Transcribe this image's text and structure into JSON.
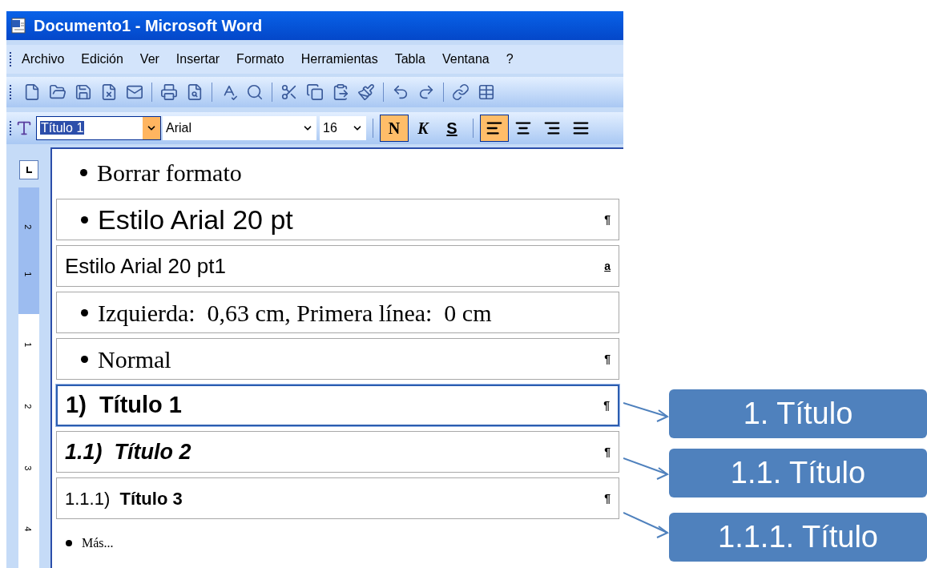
{
  "window": {
    "title": "Documento1 - Microsoft Word"
  },
  "menu": [
    "Archivo",
    "Edición",
    "Ver",
    "Insertar",
    "Formato",
    "Herramientas",
    "Tabla",
    "Ventana",
    "?"
  ],
  "format_bar": {
    "style": "Título 1",
    "font": "Arial",
    "size": "16",
    "buttons": [
      {
        "label": "N",
        "kind": "bold",
        "selected": true
      },
      {
        "label": "K",
        "kind": "italic",
        "selected": false
      },
      {
        "label": "S",
        "kind": "underline",
        "selected": false
      }
    ],
    "align": [
      {
        "kind": "left",
        "selected": true
      },
      {
        "kind": "center",
        "selected": false
      },
      {
        "kind": "right",
        "selected": false
      },
      {
        "kind": "justify",
        "selected": false
      }
    ]
  },
  "ruler": {
    "labels": [
      "2",
      "1",
      "1",
      "2",
      "3",
      "4"
    ]
  },
  "styles": [
    {
      "kind": "clear",
      "text": "Borrar formato",
      "bullet": true,
      "selected": false
    },
    {
      "kind": "sans-large",
      "text": "Estilo Arial 20 pt",
      "bullet": true,
      "mark": "¶",
      "selected": false
    },
    {
      "kind": "sans-medium",
      "text": "Estilo Arial 20 pt1",
      "bullet": false,
      "mark": "a",
      "selected": false
    },
    {
      "kind": "serif",
      "text": "Izquierda:  0,63 cm, Primera línea:  0 cm",
      "bullet": true,
      "selected": false
    },
    {
      "kind": "serif",
      "text": "Normal",
      "bullet": true,
      "mark": "¶",
      "selected": false
    },
    {
      "kind": "heading1",
      "text": "1)  Título 1",
      "bullet": false,
      "mark": "¶",
      "selected": true
    },
    {
      "kind": "heading2",
      "text": "1.1)  Título 2",
      "bullet": false,
      "mark": "¶",
      "selected": false
    },
    {
      "kind": "heading3",
      "text": "1.1.1)  **Título 3**",
      "bullet": false,
      "mark": "¶",
      "selected": false
    },
    {
      "kind": "more",
      "text": "Más...",
      "bullet": true,
      "selected": false
    }
  ],
  "callouts": [
    "1. Título",
    "1.1. Título",
    "1.1.1. Título"
  ]
}
